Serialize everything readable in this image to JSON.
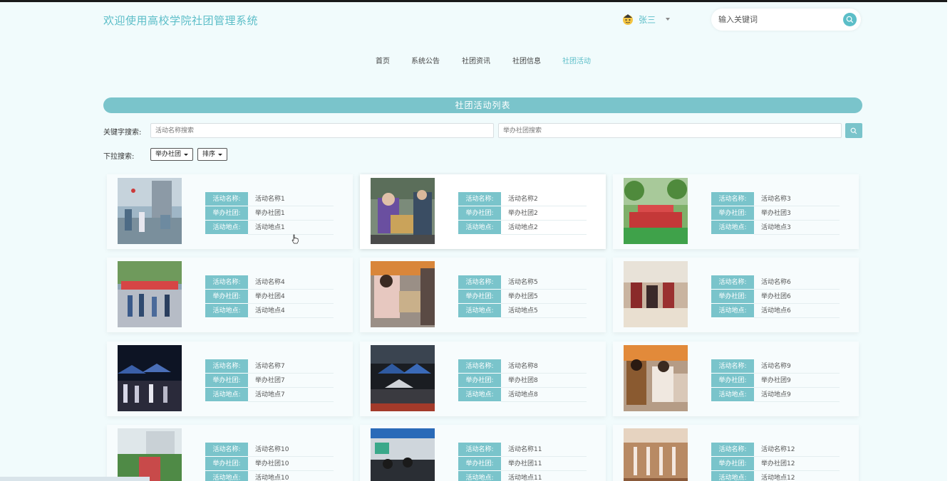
{
  "header": {
    "site_title": "欢迎使用高校学院社团管理系统",
    "user_name": "张三",
    "search_placeholder": "输入关键词"
  },
  "nav": {
    "items": [
      "首页",
      "系统公告",
      "社团资讯",
      "社团信息",
      "社团活动"
    ],
    "active_index": 4
  },
  "list": {
    "title": "社团活动列表",
    "keyword_label": "关键字搜索:",
    "name_placeholder": "活动名称搜索",
    "club_placeholder": "举办社团搜索",
    "dropdown_label": "下拉搜索:",
    "dropdowns": [
      "举办社团",
      "排序"
    ]
  },
  "card_labels": {
    "name": "活动名称:",
    "club": "举办社团:",
    "place": "活动地点:"
  },
  "cards": [
    {
      "name": "活动名称1",
      "club": "举办社团1",
      "place": "活动地点1"
    },
    {
      "name": "活动名称2",
      "club": "举办社团2",
      "place": "活动地点2"
    },
    {
      "name": "活动名称3",
      "club": "举办社团3",
      "place": "活动地点3"
    },
    {
      "name": "活动名称4",
      "club": "举办社团4",
      "place": "活动地点4"
    },
    {
      "name": "活动名称5",
      "club": "举办社团5",
      "place": "活动地点5"
    },
    {
      "name": "活动名称6",
      "club": "举办社团6",
      "place": "活动地点6"
    },
    {
      "name": "活动名称7",
      "club": "举办社团7",
      "place": "活动地点7"
    },
    {
      "name": "活动名称8",
      "club": "举办社团8",
      "place": "活动地点8"
    },
    {
      "name": "活动名称9",
      "club": "举办社团9",
      "place": "活动地点9"
    },
    {
      "name": "活动名称10",
      "club": "举办社团10",
      "place": "活动地点10"
    },
    {
      "name": "活动名称11",
      "club": "举办社团11",
      "place": "活动地点11"
    },
    {
      "name": "活动名称12",
      "club": "举办社团12",
      "place": "活动地点12"
    }
  ],
  "colors": {
    "accent": "#5cbec8",
    "label_bg": "#7ac4cb",
    "page_bg": "#f1fbfc"
  }
}
